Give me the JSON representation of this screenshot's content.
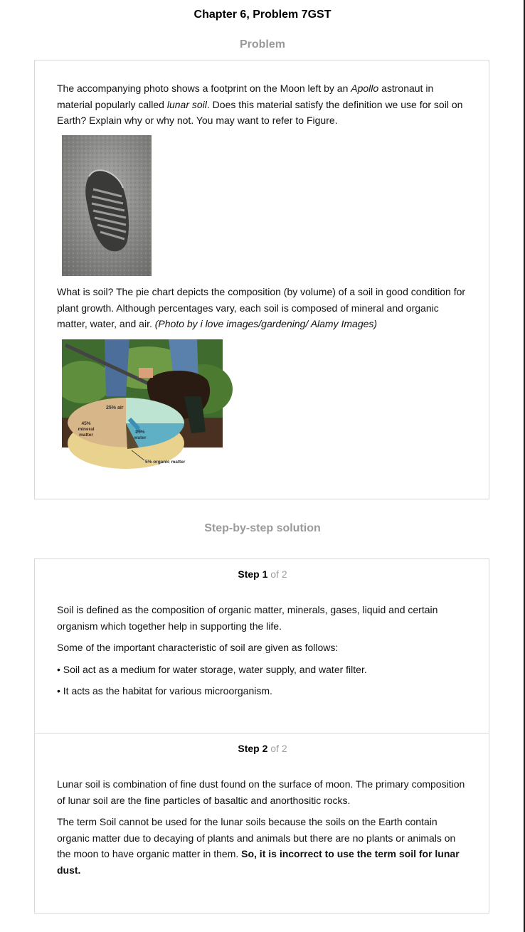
{
  "page": {
    "title": "Chapter 6, Problem 7GST",
    "problem_heading": "Problem",
    "solution_heading": "Step-by-step solution"
  },
  "problem": {
    "p1_a": "The accompanying photo shows a footprint on the Moon left by an ",
    "p1_em1": "Apollo",
    "p1_b": " astronaut in material popularly called ",
    "p1_em2": "lunar soil",
    "p1_c": ". Does this material satisfy the definition we use for soil on Earth? Explain why or why not. You may want to refer to Figure.",
    "p2_a": "What is soil? The pie chart depicts the composition (by volume) of a soil in good condition for plant growth. Although percentages vary, each soil is composed of mineral and organic matter, water, and air. ",
    "p2_em": "(Photo by i love images/gardening/ Alamy Images)",
    "pie_labels": {
      "air": "25% air",
      "mineral_1": "45%",
      "mineral_2": "mineral",
      "mineral_3": "matter",
      "water_1": "25%",
      "water_2": "water",
      "organic": "5% organic matter"
    }
  },
  "steps": [
    {
      "label": "Step ",
      "number": "1",
      "of": " of 2",
      "paragraphs": [
        "Soil is defined as the composition of organic matter, minerals, gases, liquid and certain organism which together help in supporting the life.",
        "Some of the important characteristic of soil are given as follows:",
        "• Soil act as a medium for water storage, water supply, and water filter.",
        "• It acts as the habitat for various microorganism."
      ]
    },
    {
      "label": "Step ",
      "number": "2",
      "of": " of 2",
      "paragraphs": [
        "Lunar soil is combination of fine dust found on the surface of moon. The primary composition of lunar soil are the fine particles of basaltic and anorthositic rocks."
      ],
      "final_a": "The term Soil cannot be used for the lunar soils because the soils on the Earth contain organic matter due to decaying of plants and animals but there are no plants or animals on the moon to have organic matter in them. ",
      "final_bold": "So, it is incorrect to use the term soil for lunar dust."
    }
  ]
}
